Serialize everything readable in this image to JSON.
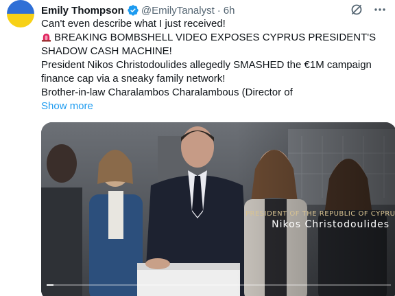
{
  "author": {
    "display_name": "Emily Thompson",
    "handle": "@EmilyTanalyst",
    "separator": "·",
    "timestamp": "6h",
    "avatar": "ukraine-flag-avatar",
    "verified_icon": "verified-badge-icon"
  },
  "actions": {
    "grok_icon": "grok-icon",
    "more_icon": "more-icon"
  },
  "tweet": {
    "lines": [
      "Can't even describe what I just received!",
      "BREAKING BOMBSHELL VIDEO EXPOSES CYPRUS PRESIDENT'S",
      "SHADOW CASH MACHINE!",
      "President Nikos Christodoulides allegedly SMASHED the €1M campaign",
      "finance cap via a sneaky family network!",
      "Brother-in-law Charalambos Charalambous (Director of"
    ],
    "emoji": "🚨",
    "show_more": "Show more"
  },
  "media": {
    "caption_title": "PRESIDENT OF THE REPUBLIC OF CYPRUS",
    "caption_name": "Nikos Christodoulides",
    "progress": 0.02
  },
  "colors": {
    "link": "#1d9bf0",
    "verified": "#1d9bf0",
    "secondary": "#536471",
    "flag_blue": "#2f6fd6",
    "flag_yellow": "#f7d117"
  }
}
